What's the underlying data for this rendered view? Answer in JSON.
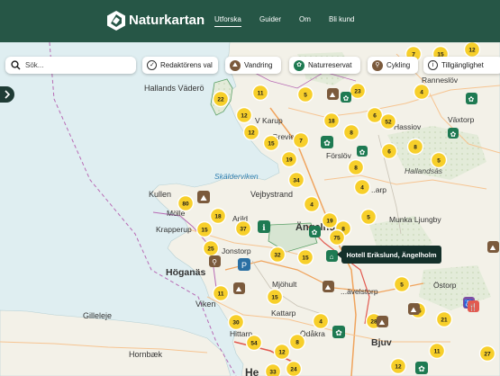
{
  "app": {
    "brand": "Naturkartan",
    "logo_icon": "naturkartan-logo-icon"
  },
  "nav": {
    "items": [
      {
        "label": "Utforska",
        "active": true
      },
      {
        "label": "Guider",
        "active": false
      },
      {
        "label": "Om",
        "active": false
      },
      {
        "label": "Bli kund",
        "active": false
      }
    ]
  },
  "search": {
    "placeholder": "Sök..."
  },
  "filters": [
    {
      "label": "Redaktörens val",
      "icon": "check-circle-icon"
    },
    {
      "label": "Vandring",
      "icon": "hiker-icon"
    },
    {
      "label": "Naturreservat",
      "icon": "flower-icon"
    },
    {
      "label": "Cykling",
      "icon": "cyclist-icon"
    },
    {
      "label": "Tillgänglighet",
      "icon": "accessibility-icon",
      "dropdown": true
    }
  ],
  "tooltip": {
    "text": "Hotell Erikslund, Ängelholm"
  },
  "map_labels": {
    "hallands_vadero": "Hallands Väderö",
    "karup": "V Karup",
    "grevie": "Grevie",
    "hassleholm": "Hassiov",
    "ranneslov": "Ranneslöv",
    "vaxtorp": "Växtorp",
    "hallandsas": "Hallandsås",
    "skalderviken": "Skälderviken",
    "vejbystrand": "Vejbystrand",
    "kullen": "Kullen",
    "molle": "Mölle",
    "krapperup": "Krapperup",
    "arild": "Arild",
    "angelholm": "Ängelholm",
    "munka": "Munka Ljungby",
    "jonstorp": "Jonstorp",
    "hoganas": "Höganäs",
    "mjohult": "Mjöhult",
    "ostorp": "Östorp",
    "kattarp": "Kattarp",
    "viken": "Viken",
    "hittarp": "Hittarp",
    "odakra": "Ödåkra",
    "astorp": "Åstorp",
    "bjuv": "Bjuv",
    "gilleleje": "Gilleleje",
    "hornbaek": "Hornbæk",
    "helsingborg": "He",
    "fosie": "Förslöv",
    "vedby": "Vedby",
    "kvarp": "..arp",
    "stovelstorp": "...ävelstorp"
  },
  "markers": {
    "clusters": [
      "12",
      "7",
      "15",
      "22",
      "11",
      "5",
      "23",
      "4",
      "12",
      "18",
      "6",
      "52",
      "12",
      "8",
      "8",
      "15",
      "7",
      "6",
      "8",
      "19",
      "4",
      "5",
      "34",
      "80",
      "18",
      "37",
      "4",
      "5",
      "19",
      "8",
      "15",
      "75",
      "25",
      "32",
      "15",
      "11",
      "15",
      "5",
      "30",
      "4",
      "28",
      "15",
      "21",
      "54",
      "12",
      "8",
      "24",
      "33",
      "11",
      "12",
      "27"
    ],
    "pins": [
      {
        "name": "hiker-poi-icon",
        "label": ""
      },
      {
        "name": "hotel-poi-icon",
        "label": ""
      }
    ]
  },
  "colors": {
    "topbar": "#265646",
    "cluster": "#f7cf2a",
    "sea": "#dfeef1",
    "land": "#f3f1e8",
    "pin": "#1e7a52"
  }
}
